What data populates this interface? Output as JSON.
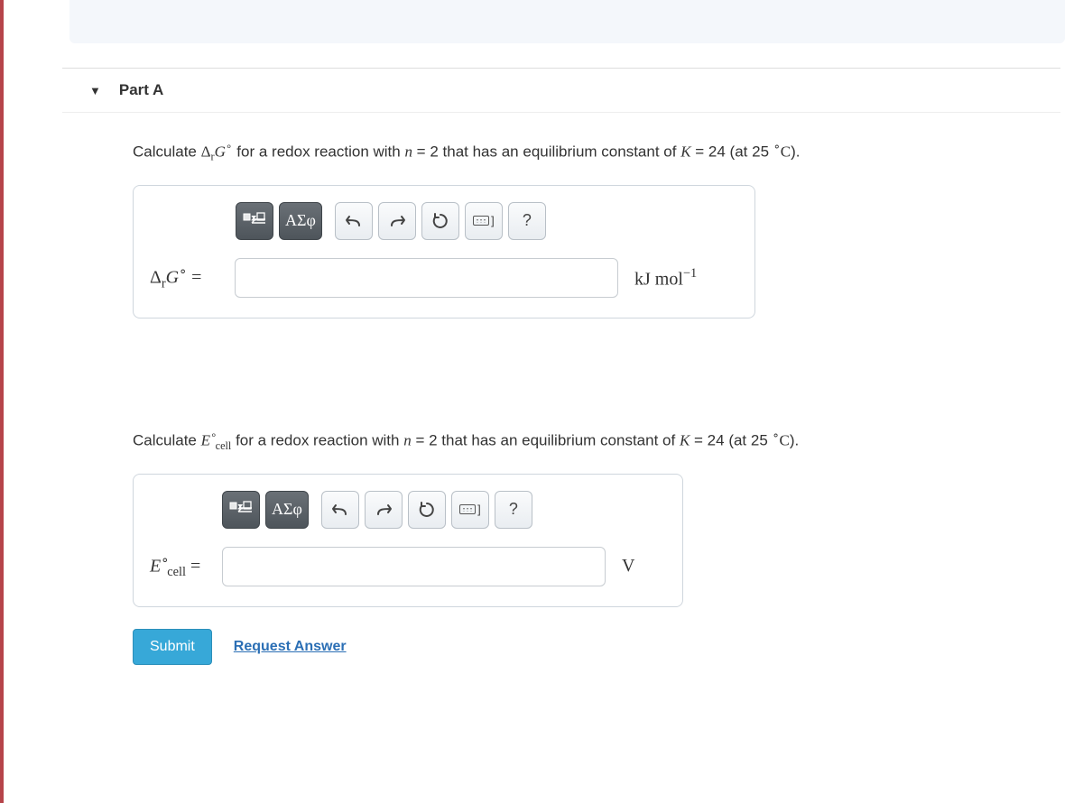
{
  "partHeader": {
    "label": "Part A"
  },
  "question1": {
    "pre": "Calculate ",
    "varPrefix": "Δ",
    "varSub": "r",
    "varMain": "G",
    "varSup": "∘",
    "mid1": " for a redox reaction with ",
    "nVar": "n",
    "nVal": " = 2",
    "mid2": " that has an equilibrium constant of ",
    "kVar": "K",
    "kVal": " = 24",
    "mid3": " (at 25 ",
    "tempUnit": "C",
    "end": ")."
  },
  "toolbar": {
    "templateLabel": "",
    "greekLabel": "ΑΣφ",
    "keyboardBracket": "]",
    "helpLabel": "?"
  },
  "answer1": {
    "lhsDelta": "Δ",
    "lhsSub": "r",
    "lhsMain": "G",
    "lhsSup": "∘",
    "eq": " = ",
    "value": "",
    "unitsPrefix": "kJ",
    "unitsMol": " mol",
    "unitsExp": "−1"
  },
  "question2": {
    "pre": "Calculate ",
    "varMain": "E",
    "varSup": "∘",
    "varSub": "cell",
    "mid1": " for a redox reaction with ",
    "nVar": "n",
    "nVal": " = 2",
    "mid2": " that has an equilibrium constant of ",
    "kVar": "K",
    "kVal": " = 24",
    "mid3": " (at 25 ",
    "tempUnit": "C",
    "end": ")."
  },
  "answer2": {
    "lhsMain": "E",
    "lhsSup": "∘",
    "lhsSub": "cell",
    "eq": " = ",
    "value": "",
    "units": "V"
  },
  "buttons": {
    "submit": "Submit",
    "request": "Request Answer"
  }
}
